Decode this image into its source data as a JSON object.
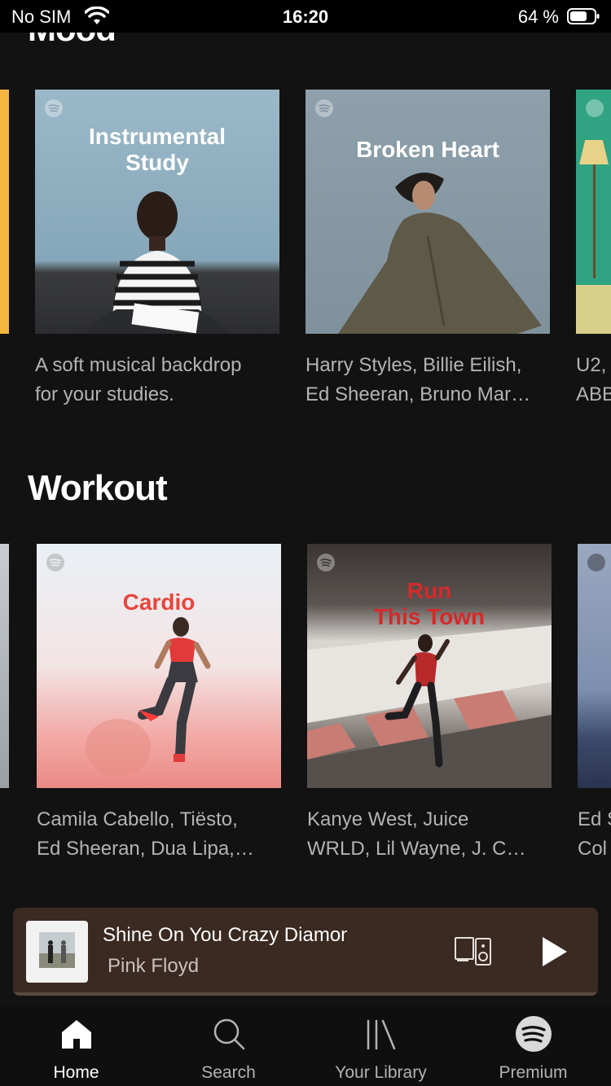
{
  "status_bar": {
    "carrier": "No SIM",
    "time": "16:20",
    "battery_percent": "64 %"
  },
  "sections": [
    {
      "title": "Mood",
      "cards": [
        {
          "cover_title": "Instrumental Study",
          "cover_title_line1": "Instrumental",
          "cover_title_line2": "Study",
          "desc_line1": "A soft musical backdrop",
          "desc_line2": "for your studies."
        },
        {
          "cover_title": "Broken Heart",
          "desc_line1": "Harry Styles, Billie Eilish,",
          "desc_line2": "Ed Sheeran, Bruno Mar…"
        },
        {
          "desc_line1": "U2,",
          "desc_line2": "ABB"
        }
      ]
    },
    {
      "title": "Workout",
      "cards": [
        {
          "cover_title": "Cardio",
          "desc_line1": "Camila Cabello, Tiësto,",
          "desc_line2": "Ed Sheeran, Dua Lipa,…"
        },
        {
          "cover_title_line1": "Run",
          "cover_title_line2": "This Town",
          "desc_line1": "Kanye West, Juice",
          "desc_line2": "WRLD, Lil Wayne, J. C…"
        },
        {
          "desc_line1": "Ed S",
          "desc_line2": "Col"
        }
      ]
    }
  ],
  "now_playing": {
    "track": "Shine On You Crazy Diamond, Pts",
    "artist": "Pink Floyd"
  },
  "tabbar": [
    {
      "label": "Home",
      "icon": "home-icon",
      "active": true
    },
    {
      "label": "Search",
      "icon": "search-icon"
    },
    {
      "label": "Your Library",
      "icon": "library-icon"
    },
    {
      "label": "Premium",
      "icon": "spotify-icon"
    }
  ],
  "colors": {
    "background": "#121212",
    "accent_cardio": "#e8453c",
    "accent_run": "#d42a2a",
    "mini_player": "#3a2a22"
  }
}
